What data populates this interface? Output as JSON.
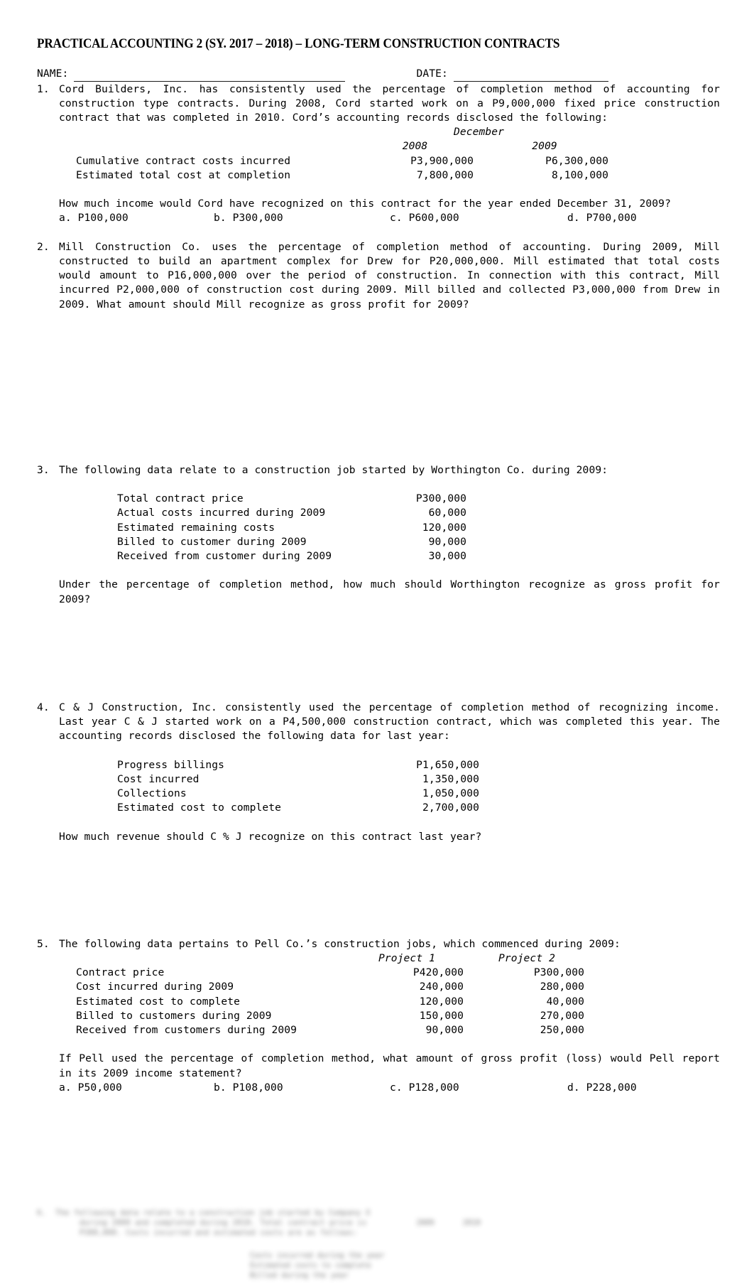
{
  "document": {
    "title": "PRACTICAL ACCOUNTING 2 (SY. 2017 – 2018) – LONG-TERM CONSTRUCTION CONTRACTS",
    "name_label": "NAME:",
    "date_label": "DATE:"
  },
  "questions": [
    {
      "number": "1.",
      "text_lines": [
        "Cord Builders, Inc. has consistently used the percentage of completion method of accounting for construction type contracts. During 2008, Cord started work on a P9,000,000 fixed price construction contract that was completed in 2010. Cord’s accounting records disclosed the following:"
      ],
      "table": {
        "span_header": "December",
        "headers": [
          "",
          "2008",
          "2009"
        ],
        "rows": [
          [
            "Cumulative contract costs incurred",
            "P3,900,000",
            "P6,300,000"
          ],
          [
            "Estimated total cost at completion",
            "7,800,000",
            "8,100,000"
          ]
        ]
      },
      "prompt": "How much income would Cord have recognized on this contract for the year ended December 31, 2009?",
      "choices": [
        "a. P100,000",
        "b. P300,000",
        "c. P600,000",
        "d. P700,000"
      ]
    },
    {
      "number": "2.",
      "text_lines": [
        "Mill Construction Co. uses the percentage of completion method of accounting. During 2009, Mill constructed to build an apartment complex for Drew for P20,000,000. Mill estimated that total costs would amount to P16,000,000 over the period of construction. In connection with this contract, Mill incurred P2,000,000 of construction cost during 2009. Mill billed and collected P3,000,000 from Drew in 2009. What amount should Mill recognize as gross profit for 2009?"
      ]
    },
    {
      "number": "3.",
      "text_lines": [
        "The following data relate to a construction job started by Worthington Co. during 2009:"
      ],
      "table": {
        "headers": [
          "",
          ""
        ],
        "rows": [
          [
            "Total contract price",
            "P300,000"
          ],
          [
            "Actual costs incurred during 2009",
            "60,000"
          ],
          [
            "Estimated remaining costs",
            "120,000"
          ],
          [
            "Billed to customer during 2009",
            "90,000"
          ],
          [
            "Received from customer during 2009",
            "30,000"
          ]
        ]
      },
      "prompt": "Under the percentage of completion method, how much should Worthington recognize as gross profit for 2009?"
    },
    {
      "number": "4.",
      "text_lines": [
        "C & J Construction, Inc. consistently used the percentage of completion method of recognizing income. Last year C & J started work on a P4,500,000 construction contract, which was completed this year. The accounting records disclosed the following data for last year:"
      ],
      "table": {
        "headers": [
          "",
          ""
        ],
        "rows": [
          [
            "Progress billings",
            "P1,650,000"
          ],
          [
            "Cost incurred",
            "1,350,000"
          ],
          [
            "Collections",
            "1,050,000"
          ],
          [
            "Estimated cost to complete",
            "2,700,000"
          ]
        ]
      },
      "prompt": "How much revenue should C % J recognize on this contract last year?"
    },
    {
      "number": "5.",
      "text_lines": [
        "The following data pertains to Pell Co.’s construction jobs, which commenced during 2009:"
      ],
      "table": {
        "headers": [
          "",
          "Project 1",
          "Project 2"
        ],
        "rows": [
          [
            "Contract price",
            "P420,000",
            "P300,000"
          ],
          [
            "Cost incurred during 2009",
            "240,000",
            "280,000"
          ],
          [
            "Estimated cost to complete",
            "120,000",
            "40,000"
          ],
          [
            "Billed to customers during 2009",
            "150,000",
            "270,000"
          ],
          [
            "Received from customers during 2009",
            "90,000",
            "250,000"
          ]
        ]
      },
      "prompt": "If Pell used the percentage of completion method, what amount of gross profit (loss) would Pell report in its 2009 income statement?",
      "choices": [
        "a. P50,000",
        "b. P108,000",
        "c. P128,000",
        "d. P228,000"
      ]
    }
  ],
  "footer_blurred": {
    "number": "6.",
    "lines": [
      "The following data relate to a construction job started by Company X",
      "during 2009 and completed during 2010. Total contract price is",
      "P300,000. Costs incurred and estimated costs are as follows:"
    ],
    "columns": [
      "2009",
      "2010"
    ],
    "rows": [
      [
        "Costs incurred during the year",
        "",
        ""
      ],
      [
        "Estimated costs to complete",
        "",
        ""
      ],
      [
        "Billed during the year",
        "",
        ""
      ]
    ]
  }
}
